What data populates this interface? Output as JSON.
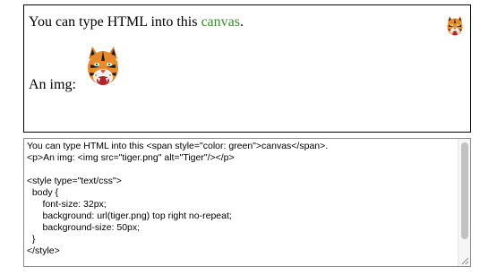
{
  "preview": {
    "line1_prefix": "You can type HTML into this ",
    "line1_highlight": "canvas",
    "line1_suffix": ".",
    "highlight_color": "#3b8a2e",
    "line2_label": "An img:",
    "image_icon": "tiger-head-icon",
    "background_icon": "tiger-head-icon"
  },
  "editor": {
    "lines": [
      "You can type HTML into this <span style=\"color: green\">canvas</span>.",
      "<p>An img: <img src=\"tiger.png\" alt=\"Tiger\"/></p>",
      "",
      "<style type=\"text/css\">",
      "  body {",
      "      font-size: 32px;",
      "      background: url(tiger.png) top right no-repeat;",
      "      background-size: 50px;",
      "  }",
      "</style>"
    ]
  }
}
